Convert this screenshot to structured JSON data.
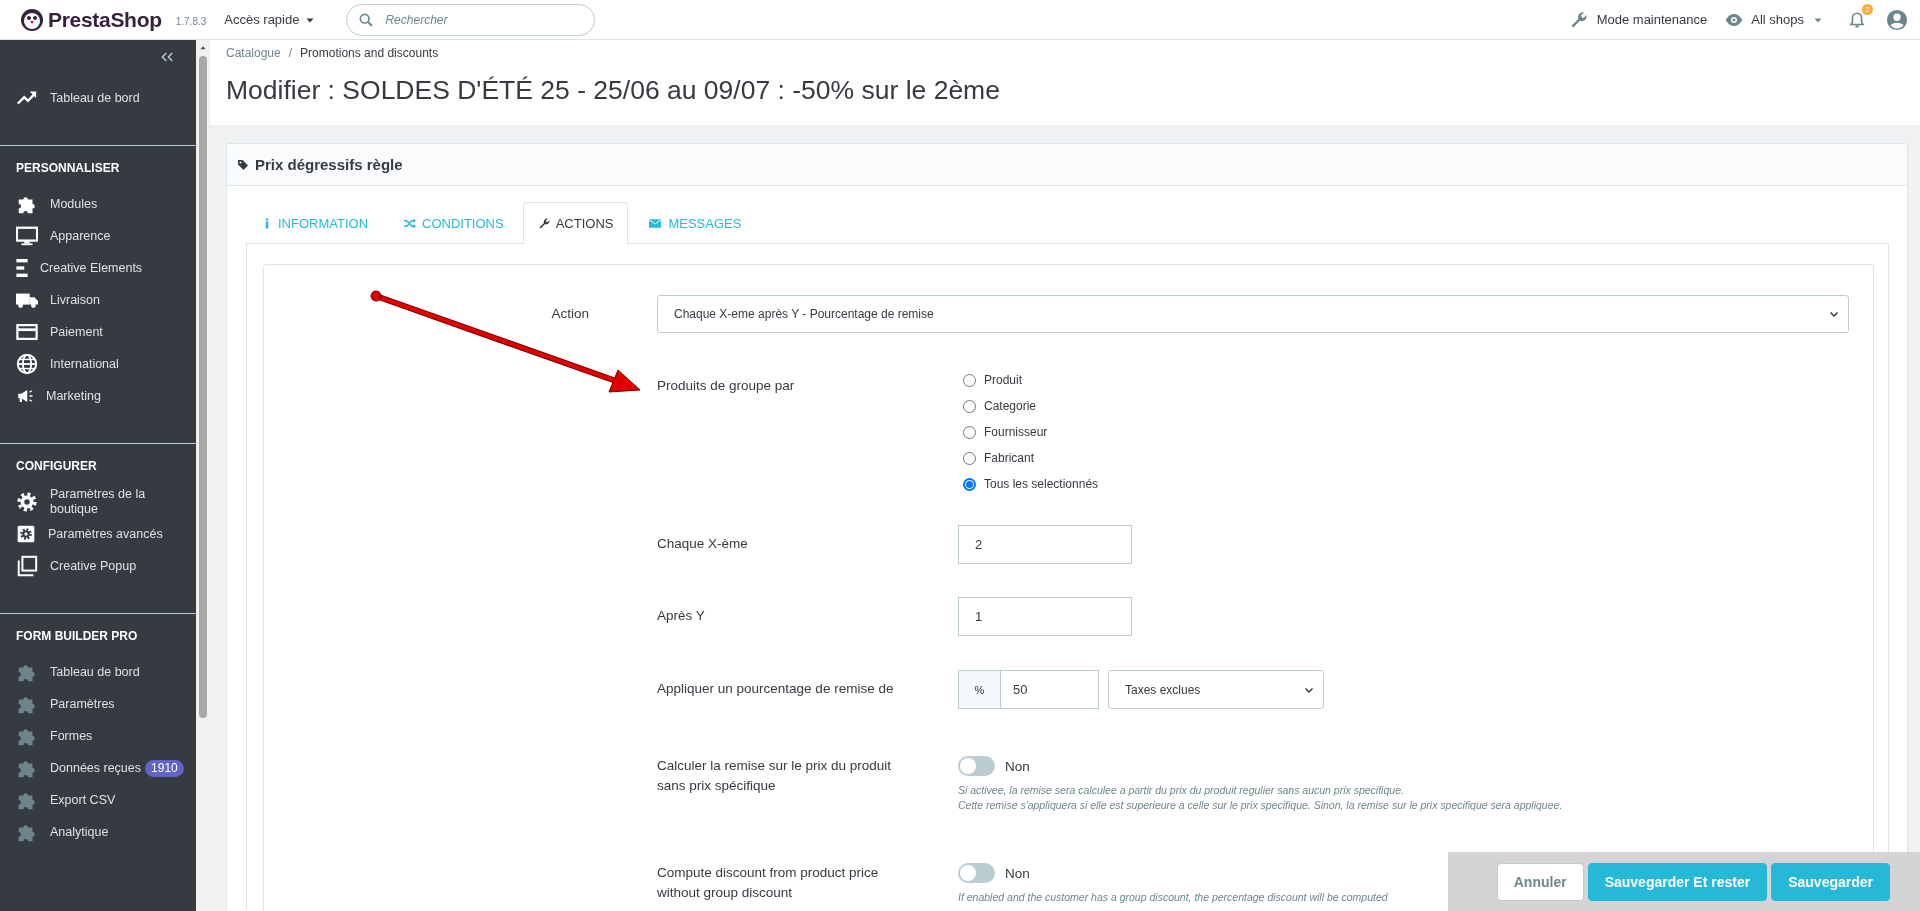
{
  "header": {
    "brand": "PrestaShop",
    "version": "1.7.8.3",
    "quick_access": "Accès rapide",
    "search": {
      "placeholder": "Rechercher"
    },
    "maintenance": "Mode maintenance",
    "shop_selector": "All shops",
    "notifications_count": "2"
  },
  "sidebar": {
    "top_items": [
      {
        "label": "Tableau de bord"
      }
    ],
    "sections": [
      {
        "title": "PERSONNALISER",
        "items": [
          {
            "label": "Modules"
          },
          {
            "label": "Apparence"
          },
          {
            "label": "Creative Elements"
          },
          {
            "label": "Livraison"
          },
          {
            "label": "Paiement"
          },
          {
            "label": "International"
          },
          {
            "label": "Marketing"
          }
        ]
      },
      {
        "title": "CONFIGURER",
        "items": [
          {
            "label": "Paramètres de la boutique"
          },
          {
            "label": "Paramètres avancés"
          },
          {
            "label": "Creative Popup"
          }
        ]
      },
      {
        "title": "FORM BUILDER PRO",
        "items": [
          {
            "label": "Tableau de bord"
          },
          {
            "label": "Paramètres"
          },
          {
            "label": "Formes"
          },
          {
            "label": "Données reçues",
            "badge": "1910"
          },
          {
            "label": "Export CSV"
          },
          {
            "label": "Analytique"
          }
        ]
      }
    ]
  },
  "breadcrumb": {
    "items": [
      "Catalogue",
      "Promotions and discounts"
    ],
    "separator": "/"
  },
  "page_title": "Modifier : SOLDES D'ÉTÉ 25 - 25/06 au 09/07 : -50% sur le 2ème",
  "panel": {
    "title": "Prix dégressifs règle",
    "tabs": [
      {
        "label": "INFORMATION",
        "selected": false
      },
      {
        "label": "CONDITIONS",
        "selected": false
      },
      {
        "label": "ACTIONS",
        "selected": true
      },
      {
        "label": "MESSAGES",
        "selected": false
      }
    ],
    "form": {
      "action": {
        "label": "Action",
        "value": "Chaque X-eme après Y - Pourcentage de remise"
      },
      "group_by": {
        "label": "Produits de groupe par",
        "options": [
          {
            "label": "Produit",
            "selected": false
          },
          {
            "label": "Categorie",
            "selected": false
          },
          {
            "label": "Fournisseur",
            "selected": false
          },
          {
            "label": "Fabricant",
            "selected": false
          },
          {
            "label": "Tous les selectionnés",
            "selected": true
          }
        ]
      },
      "every_x": {
        "label": "Chaque X-ème",
        "value": "2"
      },
      "after_y": {
        "label": "Après Y",
        "value": "1"
      },
      "percentage": {
        "label": "Appliquer un pourcentage de remise de",
        "addon": "%",
        "value": "50",
        "tax": "Taxes exclues"
      },
      "switches": [
        {
          "label": "Calculer la remise sur le prix du produit sans prix spécifique",
          "on": false,
          "state_label": "Non",
          "help": [
            "Si activee, la remise sera calculee a partir du prix du produit regulier sans aucun prix specifique.",
            "Cette remise s'appliquera si elle est superieure a celle sur le prix specifique. Sinon, la remise sur le prix specifique sera appliquee."
          ]
        },
        {
          "label": "Compute discount from product price without group discount",
          "on": false,
          "state_label": "Non",
          "help": [
            "If enabled and the customer has a group discount, the percentage discount will be computed"
          ]
        }
      ]
    }
  },
  "footer_buttons": [
    {
      "label": "Annuler",
      "kind": "secondary"
    },
    {
      "label": "Sauvegarder Et rester",
      "kind": "primary"
    },
    {
      "label": "Sauvegarder",
      "kind": "primary"
    }
  ]
}
